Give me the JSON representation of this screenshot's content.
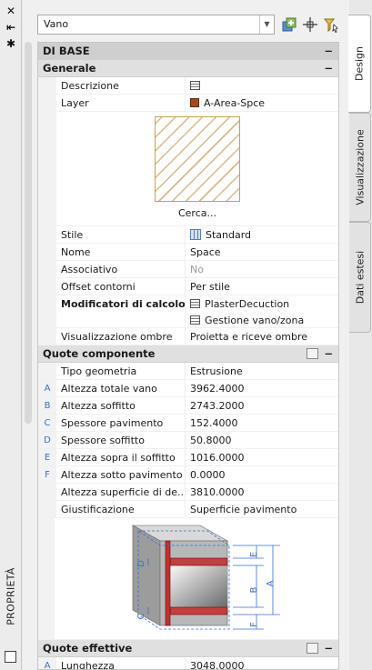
{
  "strip": {
    "close_glyph": "✕",
    "pin_glyph": "⇤",
    "settings_glyph": "✱",
    "title": "PROPRIETÀ"
  },
  "toolbar": {
    "selected_object": "Vano",
    "buttons": [
      "add-object-icon",
      "pickadd-icon",
      "quick-select-icon"
    ]
  },
  "tabs": [
    "Design",
    "Visualizzazione",
    "Dati estesi"
  ],
  "sections": {
    "base": {
      "title": "DI BASE",
      "collapse_glyph": "−"
    },
    "generale": {
      "title": "Generale",
      "collapse_glyph": "−",
      "rows": {
        "descrizione": {
          "label": "Descrizione",
          "value": ""
        },
        "layer": {
          "label": "Layer",
          "value": "A-Area-Spce",
          "swatch": "#a34a1c"
        },
        "preview_link": "Cerca...",
        "stile": {
          "label": "Stile",
          "value": "Standard"
        },
        "nome": {
          "label": "Nome",
          "value": "Space"
        },
        "associativo": {
          "label": "Associativo",
          "value": "No"
        },
        "offset": {
          "label": "Offset contorni",
          "value": "Per stile"
        },
        "modificatori": {
          "label": "Modificatori di calcolo",
          "value1": "PlasterDecuction",
          "value2": "Gestione vano/zona"
        },
        "visual_ombre": {
          "label": "Visualizzazione ombre",
          "value": "Proietta e riceve ombre"
        }
      }
    },
    "quote": {
      "title": "Quote componente",
      "collapse_glyph": "−",
      "rows": [
        {
          "glyph": "",
          "label": "Tipo geometria",
          "value": "Estrusione"
        },
        {
          "glyph": "A",
          "label": "Altezza totale vano",
          "value": "3962.4000"
        },
        {
          "glyph": "B",
          "label": "Altezza soffitto",
          "value": "2743.2000"
        },
        {
          "glyph": "C",
          "label": "Spessore pavimento",
          "value": "152.4000"
        },
        {
          "glyph": "D",
          "label": "Spessore soffitto",
          "value": "50.8000"
        },
        {
          "glyph": "E",
          "label": "Altezza sopra il soffitto",
          "value": "1016.0000"
        },
        {
          "glyph": "F",
          "label": "Altezza sotto pavimento",
          "value": "0.0000"
        },
        {
          "glyph": "",
          "label": "Altezza superficie di de...",
          "value": "3810.0000"
        },
        {
          "glyph": "",
          "label": "Giustificazione",
          "value": "Superficie pavimento"
        }
      ],
      "diagram_letters": {
        "a": "A",
        "b": "B",
        "c": "C",
        "d": "D",
        "e": "E",
        "f": "F"
      }
    },
    "effettive": {
      "title": "Quote effettive",
      "collapse_glyph": "−",
      "rows": [
        {
          "glyph": "A",
          "label": "Lunghezza",
          "value": "3048.0000"
        }
      ]
    }
  }
}
